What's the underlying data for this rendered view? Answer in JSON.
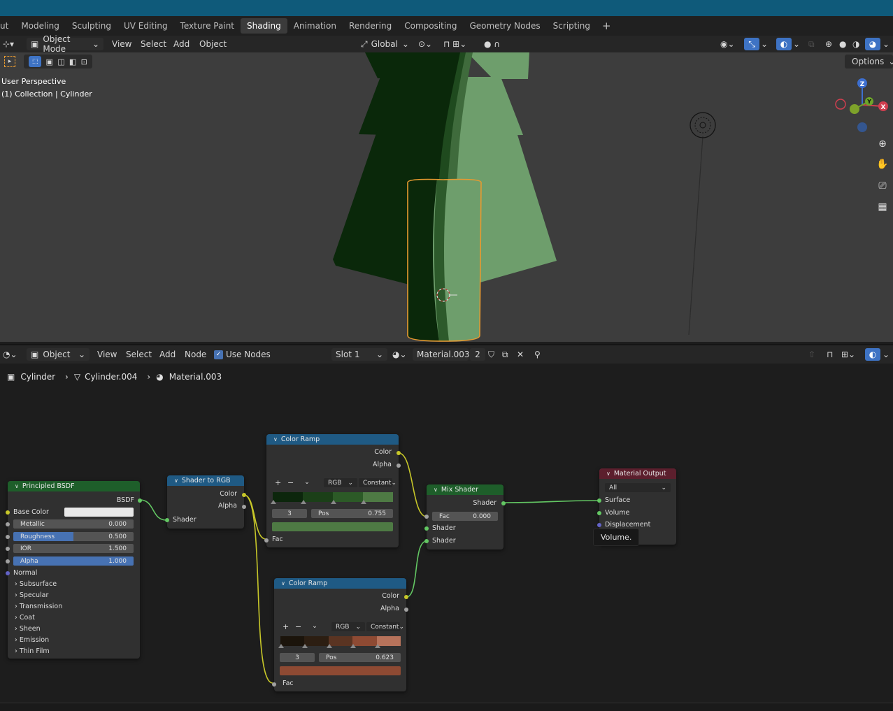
{
  "workspace_tabs": [
    "ut",
    "Modeling",
    "Sculpting",
    "UV Editing",
    "Texture Paint",
    "Shading",
    "Animation",
    "Rendering",
    "Compositing",
    "Geometry Nodes",
    "Scripting",
    "+"
  ],
  "active_tab": "Shading",
  "viewport": {
    "mode": "Object Mode",
    "menus": [
      "View",
      "Select",
      "Add",
      "Object"
    ],
    "orientation": "Global",
    "options_label": "Options",
    "overlay_line1": "User Perspective",
    "overlay_line2": "(1) Collection | Cylinder",
    "gizmo_axes": [
      "Z",
      "Y",
      "X"
    ]
  },
  "node_editor_header": {
    "editor_mode": "Object",
    "menus": [
      "View",
      "Select",
      "Add",
      "Node"
    ],
    "use_nodes_label": "Use Nodes",
    "use_nodes_checked": true,
    "slot": "Slot 1",
    "material": "Material.003",
    "user_count": "2"
  },
  "breadcrumb": [
    "Cylinder",
    "Cylinder.004",
    "Material.003"
  ],
  "nodes": {
    "principled": {
      "title": "Principled BSDF",
      "output": "BSDF",
      "base_color_label": "Base Color",
      "base_color_value": "#e8e8e8",
      "params": [
        {
          "label": "Metallic",
          "value": "0.000",
          "fill": 0
        },
        {
          "label": "Roughness",
          "value": "0.500",
          "fill": 0.5
        },
        {
          "label": "IOR",
          "value": "1.500",
          "fill": 0
        },
        {
          "label": "Alpha",
          "value": "1.000",
          "fill": 1
        }
      ],
      "normal_label": "Normal",
      "panels": [
        "Subsurface",
        "Specular",
        "Transmission",
        "Coat",
        "Sheen",
        "Emission",
        "Thin Film"
      ]
    },
    "shader_to_rgb": {
      "title": "Shader to RGB",
      "out_color": "Color",
      "out_alpha": "Alpha",
      "in_shader": "Shader"
    },
    "ramp_green": {
      "title": "Color Ramp",
      "out_color": "Color",
      "out_alpha": "Alpha",
      "mode": "RGB",
      "interp": "Constant",
      "stop_index": "3",
      "pos_label": "Pos",
      "pos_value": "0.755",
      "stop_color": "#4e7a44",
      "in_fac": "Fac",
      "bands": [
        "#0c260c",
        "#1b3f18",
        "#2c5a27",
        "#4e7a44"
      ]
    },
    "ramp_brown": {
      "title": "Color Ramp",
      "out_color": "Color",
      "out_alpha": "Alpha",
      "mode": "RGB",
      "interp": "Constant",
      "stop_index": "3",
      "pos_label": "Pos",
      "pos_value": "0.623",
      "stop_color": "#8e4a33",
      "in_fac": "Fac",
      "bands": [
        "#1b140b",
        "#2c1e12",
        "#5a3422",
        "#8e4a33",
        "#b7735b"
      ]
    },
    "mix_shader": {
      "title": "Mix Shader",
      "out_shader": "Shader",
      "fac_label": "Fac",
      "fac_value": "0.000",
      "in_shader1": "Shader",
      "in_shader2": "Shader"
    },
    "material_output": {
      "title": "Material Output",
      "target": "All",
      "in_surface": "Surface",
      "in_volume": "Volume",
      "in_displacement": "Displacement"
    }
  },
  "tooltip": "Volume.",
  "colors": {
    "accent_blue": "#4772b3",
    "selection_orange": "#e89a30",
    "tree_light": "#6e9e6c",
    "tree_dark": "#0b2a0b"
  }
}
